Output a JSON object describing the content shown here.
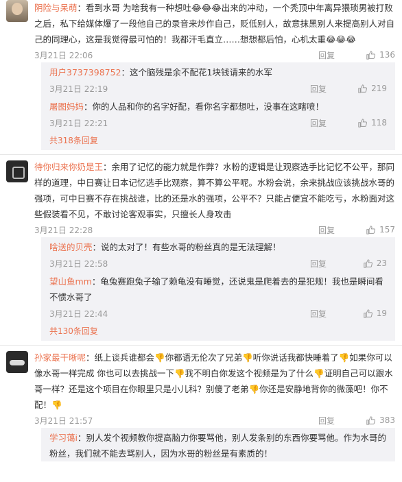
{
  "threads": [
    {
      "user": "阴险与呆萌",
      "text": "：看到水哥 为啥我有一种想吐😂😂😂出来的冲动，一个秃顶中年离异猥琐男被打败之后，私下给媒体爆了一段他自己的录音来炒作自己，贬低别人，故意抹黑别人来提高别人对自己的同理心，这是我觉得最可怕的！我都汗毛直立……想想都后怕，心机太重😂😂😂",
      "time": "3月21日 22:06",
      "reply": "回复",
      "likes": "136",
      "subs": [
        {
          "user": "用户3737398752",
          "text": "：这个脑残是余不配花1块钱请来的水军",
          "time": "3月21日 22:19",
          "reply": "回复",
          "likes": "219"
        },
        {
          "user": "屠图妈妈",
          "text": "：你的人品和你的名字好配，看你名字都想吐，没事在这瞎喷！",
          "time": "3月21日 22:21",
          "reply": "回复",
          "likes": "118"
        }
      ],
      "more": "共318条回复"
    },
    {
      "user": "待你归来你奶是王",
      "text": "：余用了记忆的能力就是作弊？水粉的逻辑是让观察选手比记忆不公平，那同样的道理，中日赛让日本记忆选手比观察，算不算公平呢。水粉会说，余来挑战应该挑战水哥的强项，可中日赛不存在挑战谁，比的还是水的强项，公平不？只能占便宜不能吃亏，水粉面对这些假装看不见，不敢讨论客观事实，只擅长人身攻击",
      "time": "3月21日 22:28",
      "reply": "回复",
      "likes": "157",
      "subs": [
        {
          "user": "啥送的贝壳",
          "text": "：说的太对了！有些水哥的粉丝真的是无法理解！",
          "time": "3月21日 22:58",
          "reply": "回复",
          "likes": "23"
        },
        {
          "user": "望山鱼mm",
          "text": "：龟兔赛跑兔子输了赖龟没有睡觉，还说鬼是爬着去的是犯规！我也是瞬间看不惯水哥了",
          "time": "3月21日 22:44",
          "reply": "回复",
          "likes": "19"
        }
      ],
      "more": "共130条回复"
    },
    {
      "user": "孙家最干晰呢",
      "text": "：纸上谈兵谁都会👎你都语无伦次了兄弟👎听你说话我都快睡着了👎如果你可以像水哥一样完成 你也可以去挑战一下👎我不明白你发这个视频是为了什么👎证明自己可以跟水哥一样？还是这个项目在你眼里只是小儿科？别傻了老弟👎你还是安静地背你的微藻吧！你不配！👎",
      "time": "3月21日 21:57",
      "reply": "回复",
      "likes": "383",
      "subs": [
        {
          "user": "学习蔼i",
          "text": "：别人发个视频教你提高脑力你要骂他，别人发条别的东西你要骂他。作为水哥的粉丝，我们就不能去骂别人，因为水哥的粉丝是有素质的！",
          "time": "",
          "reply": "",
          "likes": ""
        }
      ],
      "more": ""
    }
  ],
  "icons": {
    "like": "thumbs-up-icon"
  }
}
